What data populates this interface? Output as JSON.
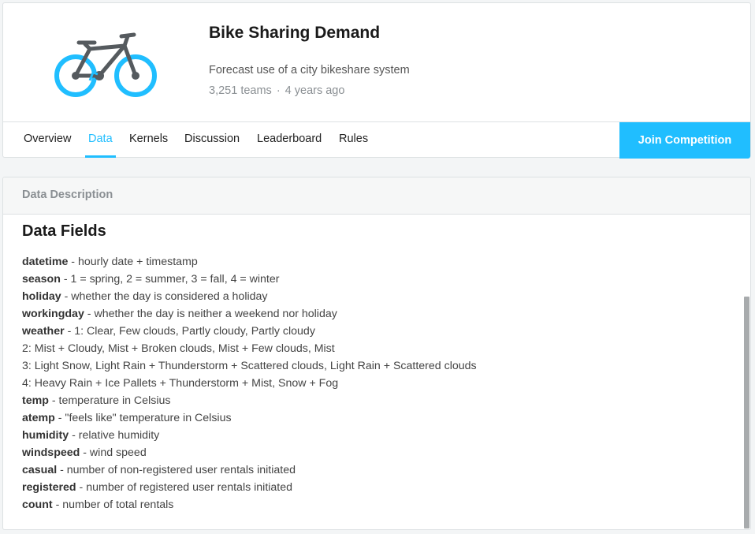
{
  "competition": {
    "title": "Bike Sharing Demand",
    "subtitle": "Forecast use of a city bikeshare system",
    "teams": "3,251 teams",
    "separator": "·",
    "age": "4 years ago"
  },
  "tabs": [
    {
      "label": "Overview",
      "active": false
    },
    {
      "label": "Data",
      "active": true
    },
    {
      "label": "Kernels",
      "active": false
    },
    {
      "label": "Discussion",
      "active": false
    },
    {
      "label": "Leaderboard",
      "active": false
    },
    {
      "label": "Rules",
      "active": false
    }
  ],
  "join_button": "Join Competition",
  "description": {
    "header": "Data Description",
    "section_title": "Data Fields",
    "lines": [
      {
        "name": "datetime",
        "text": " - hourly date + timestamp"
      },
      {
        "name": "season",
        "text": " -  1 = spring, 2 = summer, 3 = fall, 4 = winter"
      },
      {
        "name": "holiday",
        "text": " - whether the day is considered a holiday"
      },
      {
        "name": "workingday",
        "text": " - whether the day is neither a weekend nor holiday"
      },
      {
        "name": "weather",
        "text": " - 1: Clear, Few clouds, Partly cloudy, Partly cloudy"
      },
      {
        "name": "",
        "text": "2: Mist + Cloudy, Mist + Broken clouds, Mist + Few clouds, Mist"
      },
      {
        "name": "",
        "text": "3: Light Snow, Light Rain + Thunderstorm + Scattered clouds, Light Rain + Scattered clouds"
      },
      {
        "name": "",
        "text": "4: Heavy Rain + Ice Pallets + Thunderstorm + Mist, Snow + Fog"
      },
      {
        "name": "temp",
        "text": " - temperature in Celsius"
      },
      {
        "name": "atemp",
        "text": " - \"feels like\" temperature in Celsius"
      },
      {
        "name": "humidity",
        "text": " - relative humidity"
      },
      {
        "name": "windspeed",
        "text": " - wind speed"
      },
      {
        "name": "casual",
        "text": " - number of non-registered user rentals initiated"
      },
      {
        "name": "registered",
        "text": " - number of registered user rentals initiated"
      },
      {
        "name": "count",
        "text": " - number of total rentals"
      }
    ]
  },
  "icons": {
    "logo": "bicycle-icon"
  },
  "colors": {
    "accent": "#20beff",
    "bike_frame": "#555a5e"
  }
}
